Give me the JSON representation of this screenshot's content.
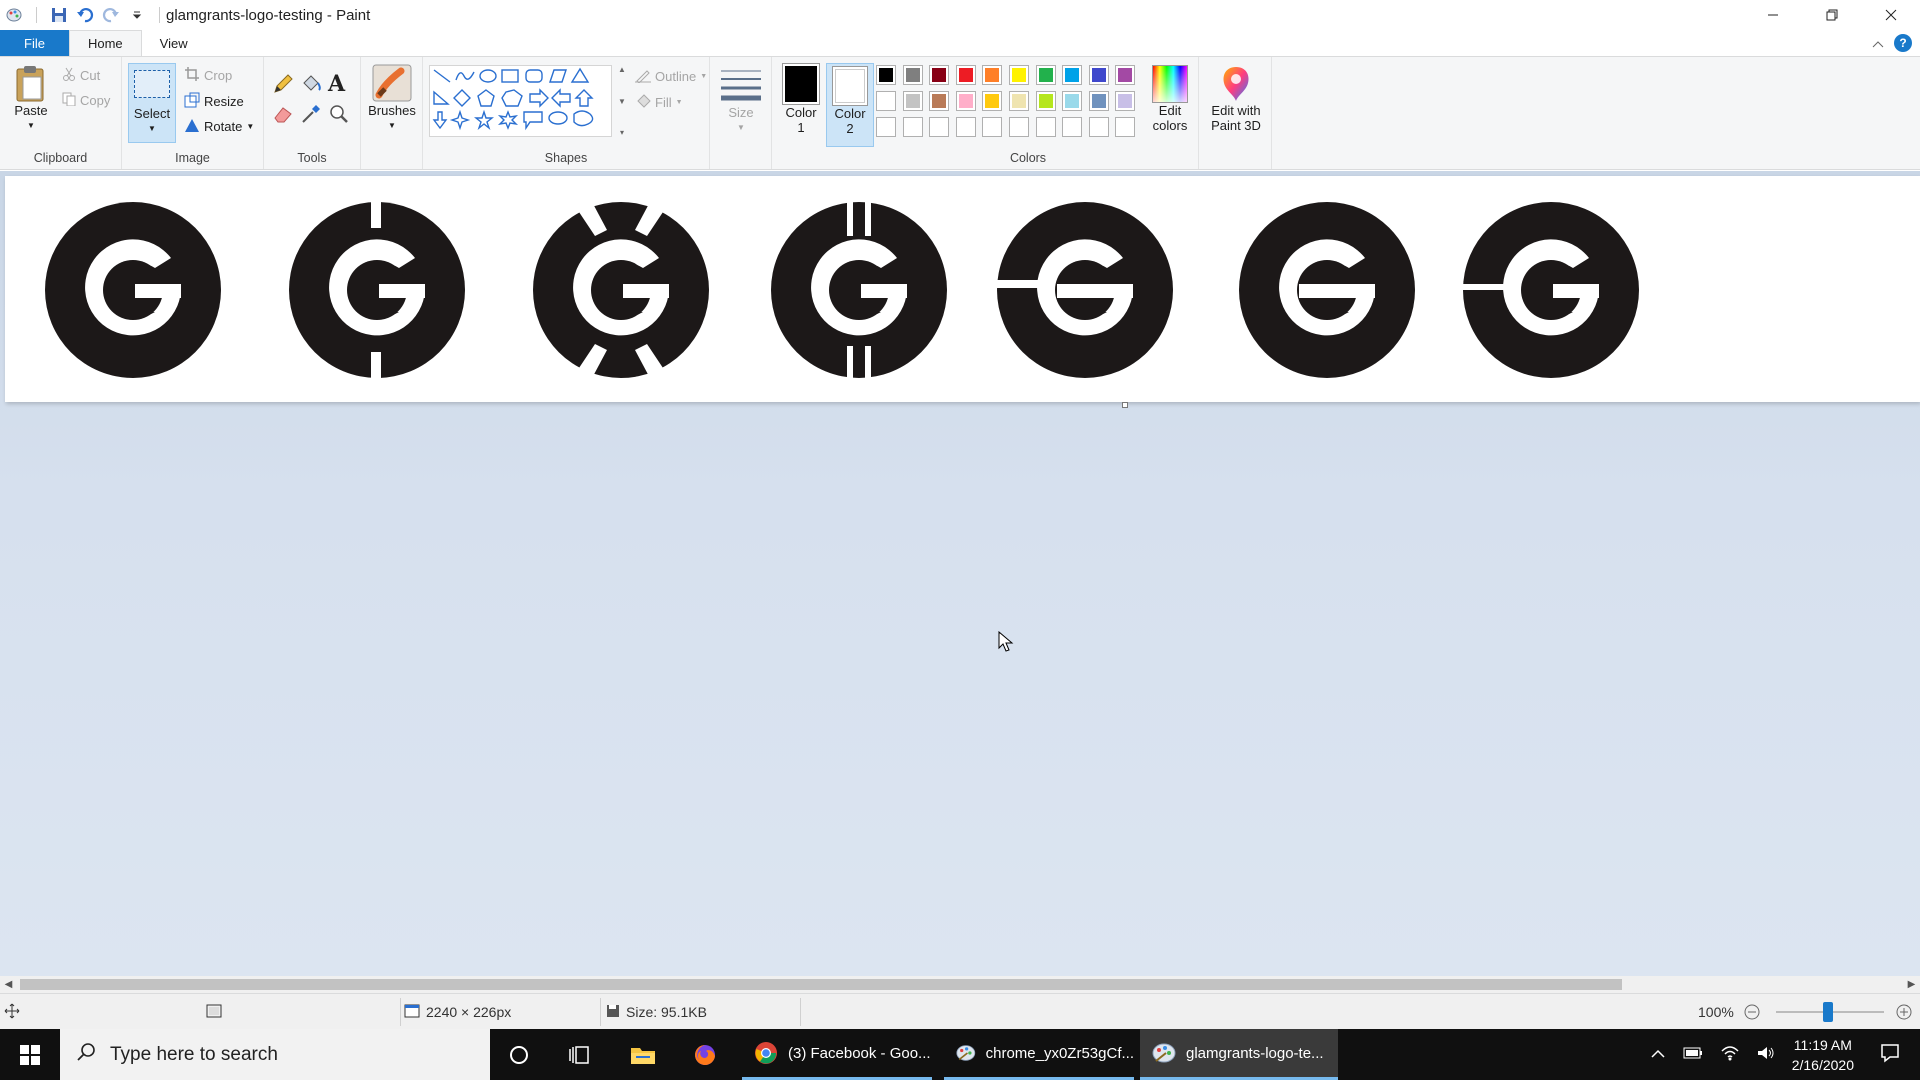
{
  "window": {
    "title": "glamgrants-logo-testing - Paint"
  },
  "tabs": [
    {
      "label": "File"
    },
    {
      "label": "Home"
    },
    {
      "label": "View"
    }
  ],
  "ribbon": {
    "clipboard": {
      "label": "Clipboard",
      "paste": "Paste",
      "cut": "Cut",
      "copy": "Copy"
    },
    "image": {
      "label": "Image",
      "select": "Select",
      "crop": "Crop",
      "resize": "Resize",
      "rotate": "Rotate"
    },
    "tools": {
      "label": "Tools"
    },
    "brushes": {
      "label": "Brushes"
    },
    "shapes": {
      "label": "Shapes",
      "outline": "Outline",
      "fill": "Fill"
    },
    "size": {
      "label": "Size"
    },
    "colors": {
      "label": "Colors",
      "color1_line1": "Color",
      "color1_line2": "1",
      "color2_line1": "Color",
      "color2_line2": "2",
      "edit_line1": "Edit",
      "edit_line2": "colors",
      "color1_value": "#000000",
      "color2_value": "#ffffff",
      "palette_row1": [
        "#000000",
        "#7f7f7f",
        "#880015",
        "#ed1c24",
        "#ff7f27",
        "#fff200",
        "#22b14c",
        "#00a2e8",
        "#3f48cc",
        "#a349a4"
      ],
      "palette_row2": [
        "#ffffff",
        "#c3c3c3",
        "#b97a57",
        "#ffaec9",
        "#ffc90e",
        "#efe4b0",
        "#b5e61d",
        "#99d9ea",
        "#7092be",
        "#c8bfe7"
      ]
    },
    "paint3d": {
      "line1": "Edit with",
      "line2": "Paint 3D"
    }
  },
  "status": {
    "dimensions": "2240 × 226px",
    "size": "Size: 95.1KB",
    "zoom": "100%"
  },
  "taskbar": {
    "search_placeholder": "Type here to search",
    "apps": [
      {
        "label": "(3) Facebook - Goo..."
      },
      {
        "label": "chrome_yx0Zr53gCf..."
      },
      {
        "label": "glamgrants-logo-te..."
      }
    ],
    "time": "11:19 AM",
    "date": "2/16/2020"
  }
}
